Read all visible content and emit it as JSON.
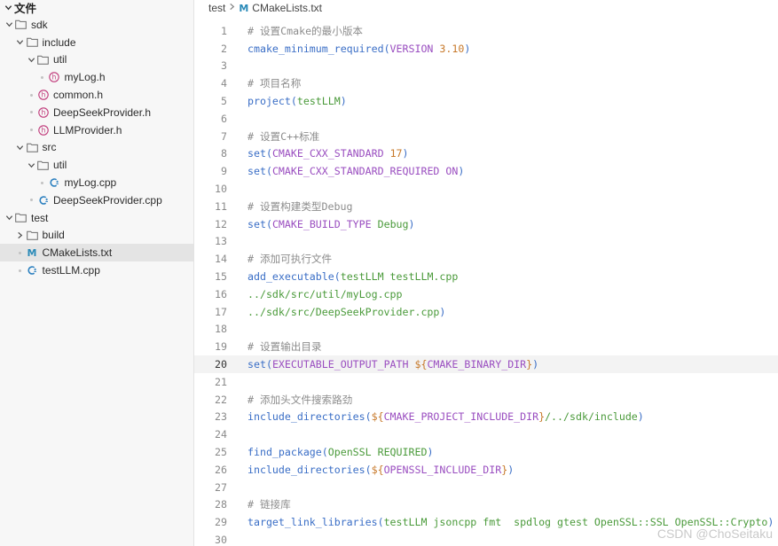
{
  "sidebar": {
    "title": "文件",
    "tree": [
      {
        "label": "sdk",
        "kind": "folder",
        "depth": 0,
        "open": true
      },
      {
        "label": "include",
        "kind": "folder",
        "depth": 1,
        "open": true
      },
      {
        "label": "util",
        "kind": "folder",
        "depth": 2,
        "open": true
      },
      {
        "label": "myLog.h",
        "kind": "header",
        "depth": 3
      },
      {
        "label": "common.h",
        "kind": "header",
        "depth": 2
      },
      {
        "label": "DeepSeekProvider.h",
        "kind": "header",
        "depth": 2
      },
      {
        "label": "LLMProvider.h",
        "kind": "header",
        "depth": 2
      },
      {
        "label": "src",
        "kind": "folder",
        "depth": 1,
        "open": true
      },
      {
        "label": "util",
        "kind": "folder",
        "depth": 2,
        "open": true
      },
      {
        "label": "myLog.cpp",
        "kind": "cpp",
        "depth": 3
      },
      {
        "label": "DeepSeekProvider.cpp",
        "kind": "cpp",
        "depth": 2
      },
      {
        "label": "test",
        "kind": "folder",
        "depth": 0,
        "open": true
      },
      {
        "label": "build",
        "kind": "folder",
        "depth": 1,
        "open": false
      },
      {
        "label": "CMakeLists.txt",
        "kind": "cmake",
        "depth": 1,
        "selected": true
      },
      {
        "label": "testLLM.cpp",
        "kind": "cpp",
        "depth": 1
      }
    ]
  },
  "breadcrumb": {
    "folder": "test",
    "file": "CMakeLists.txt",
    "file_icon": "M"
  },
  "editor": {
    "current_line": 20,
    "lines": [
      {
        "n": "1",
        "tokens": [
          {
            "t": "comment",
            "v": "# 设置Cmake的最小版本"
          }
        ]
      },
      {
        "n": "2",
        "tokens": [
          {
            "t": "func",
            "v": "cmake_minimum_required"
          },
          {
            "t": "punct",
            "v": "("
          },
          {
            "t": "kw",
            "v": "VERSION"
          },
          {
            "t": "plain",
            "v": " "
          },
          {
            "t": "num",
            "v": "3.10"
          },
          {
            "t": "punct",
            "v": ")"
          }
        ]
      },
      {
        "n": "3",
        "tokens": []
      },
      {
        "n": "4",
        "tokens": [
          {
            "t": "comment",
            "v": "# 项目名称"
          }
        ]
      },
      {
        "n": "5",
        "tokens": [
          {
            "t": "func",
            "v": "project"
          },
          {
            "t": "punct",
            "v": "("
          },
          {
            "t": "arg",
            "v": "testLLM"
          },
          {
            "t": "punct",
            "v": ")"
          }
        ]
      },
      {
        "n": "6",
        "tokens": []
      },
      {
        "n": "7",
        "tokens": [
          {
            "t": "comment",
            "v": "# 设置C++标准"
          }
        ]
      },
      {
        "n": "8",
        "tokens": [
          {
            "t": "func",
            "v": "set"
          },
          {
            "t": "punct",
            "v": "("
          },
          {
            "t": "kw",
            "v": "CMAKE_CXX_STANDARD"
          },
          {
            "t": "plain",
            "v": " "
          },
          {
            "t": "num",
            "v": "17"
          },
          {
            "t": "punct",
            "v": ")"
          }
        ]
      },
      {
        "n": "9",
        "tokens": [
          {
            "t": "func",
            "v": "set"
          },
          {
            "t": "punct",
            "v": "("
          },
          {
            "t": "kw",
            "v": "CMAKE_CXX_STANDARD_REQUIRED"
          },
          {
            "t": "plain",
            "v": " "
          },
          {
            "t": "kw",
            "v": "ON"
          },
          {
            "t": "punct",
            "v": ")"
          }
        ]
      },
      {
        "n": "10",
        "tokens": []
      },
      {
        "n": "11",
        "tokens": [
          {
            "t": "comment",
            "v": "# 设置构建类型Debug"
          }
        ]
      },
      {
        "n": "12",
        "tokens": [
          {
            "t": "func",
            "v": "set"
          },
          {
            "t": "punct",
            "v": "("
          },
          {
            "t": "kw",
            "v": "CMAKE_BUILD_TYPE"
          },
          {
            "t": "plain",
            "v": " "
          },
          {
            "t": "arg",
            "v": "Debug"
          },
          {
            "t": "punct",
            "v": ")"
          }
        ]
      },
      {
        "n": "13",
        "tokens": []
      },
      {
        "n": "14",
        "tokens": [
          {
            "t": "comment",
            "v": "# 添加可执行文件"
          }
        ]
      },
      {
        "n": "15",
        "tokens": [
          {
            "t": "func",
            "v": "add_executable"
          },
          {
            "t": "punct",
            "v": "("
          },
          {
            "t": "arg",
            "v": "testLLM testLLM.cpp"
          }
        ]
      },
      {
        "n": "16",
        "tokens": [
          {
            "t": "arg",
            "v": "../sdk/src/util/myLog.cpp"
          }
        ]
      },
      {
        "n": "17",
        "tokens": [
          {
            "t": "arg",
            "v": "../sdk/src/DeepSeekProvider.cpp"
          },
          {
            "t": "punct",
            "v": ")"
          }
        ]
      },
      {
        "n": "18",
        "tokens": []
      },
      {
        "n": "19",
        "tokens": [
          {
            "t": "comment",
            "v": "# 设置输出目录"
          }
        ]
      },
      {
        "n": "20",
        "tokens": [
          {
            "t": "func",
            "v": "set"
          },
          {
            "t": "punct",
            "v": "("
          },
          {
            "t": "kw",
            "v": "EXECUTABLE_OUTPUT_PATH"
          },
          {
            "t": "plain",
            "v": " "
          },
          {
            "t": "varwrap",
            "v": "${"
          },
          {
            "t": "var",
            "v": "CMAKE_BINARY_DIR"
          },
          {
            "t": "varwrap",
            "v": "}"
          },
          {
            "t": "punct",
            "v": ")"
          }
        ]
      },
      {
        "n": "21",
        "tokens": []
      },
      {
        "n": "22",
        "tokens": [
          {
            "t": "comment",
            "v": "# 添加头文件搜索路劲"
          }
        ]
      },
      {
        "n": "23",
        "tokens": [
          {
            "t": "func",
            "v": "include_directories"
          },
          {
            "t": "punct",
            "v": "("
          },
          {
            "t": "varwrap",
            "v": "${"
          },
          {
            "t": "var",
            "v": "CMAKE_PROJECT_INCLUDE_DIR"
          },
          {
            "t": "varwrap",
            "v": "}"
          },
          {
            "t": "arg",
            "v": "/../sdk/include"
          },
          {
            "t": "punct",
            "v": ")"
          }
        ]
      },
      {
        "n": "24",
        "tokens": []
      },
      {
        "n": "25",
        "tokens": [
          {
            "t": "func",
            "v": "find_package"
          },
          {
            "t": "punct",
            "v": "("
          },
          {
            "t": "arg",
            "v": "OpenSSL REQUIRED"
          },
          {
            "t": "punct",
            "v": ")"
          }
        ]
      },
      {
        "n": "26",
        "tokens": [
          {
            "t": "func",
            "v": "include_directories"
          },
          {
            "t": "punct",
            "v": "("
          },
          {
            "t": "varwrap",
            "v": "${"
          },
          {
            "t": "var",
            "v": "OPENSSL_INCLUDE_DIR"
          },
          {
            "t": "varwrap",
            "v": "}"
          },
          {
            "t": "punct",
            "v": ")"
          }
        ]
      },
      {
        "n": "27",
        "tokens": []
      },
      {
        "n": "28",
        "tokens": [
          {
            "t": "comment",
            "v": "# 链接库"
          }
        ]
      },
      {
        "n": "29",
        "tokens": [
          {
            "t": "func",
            "v": "target_link_libraries"
          },
          {
            "t": "punct",
            "v": "("
          },
          {
            "t": "arg",
            "v": "testLLM jsoncpp fmt  spdlog gtest OpenSSL::SSL OpenSSL::Crypto"
          },
          {
            "t": "punct",
            "v": ")"
          }
        ]
      },
      {
        "n": "30",
        "tokens": []
      }
    ]
  },
  "watermark": "CSDN @ChoSeitaku",
  "colors": {
    "comment": "#8c8c8c",
    "function": "#3a6ec6",
    "argument": "#4a9a3a",
    "keyword": "#9a4ec0",
    "number": "#c7792a",
    "header_icon": "#c0397a",
    "cpp_icon": "#2a7fbf",
    "cmake_icon": "#2a8ab8"
  }
}
